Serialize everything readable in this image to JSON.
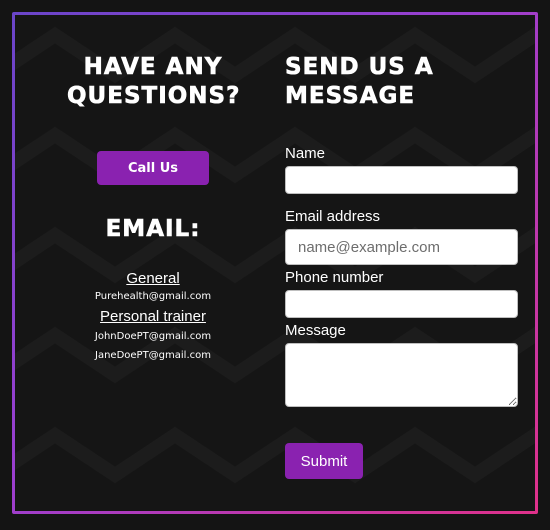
{
  "left": {
    "questions_heading": "Have any questions?",
    "call_button": "Call Us",
    "email_heading": "Email:",
    "contacts": [
      {
        "title": "General",
        "emails": [
          "Purehealth@gmail.com"
        ]
      },
      {
        "title": "Personal trainer",
        "emails": [
          "JohnDoePT@gmail.com",
          "JaneDoePT@gmail.com"
        ]
      }
    ]
  },
  "form": {
    "heading": "Send us a message",
    "name_label": "Name",
    "name_value": "",
    "email_label": "Email address",
    "email_placeholder": "name@example.com",
    "phone_label": "Phone number",
    "phone_value": "",
    "message_label": "Message",
    "message_value": "",
    "submit_label": "Submit"
  },
  "colors": {
    "background": "#151515",
    "button": "#8a22b0",
    "border_gradient": [
      "#6a45c9",
      "#e0318a"
    ]
  }
}
